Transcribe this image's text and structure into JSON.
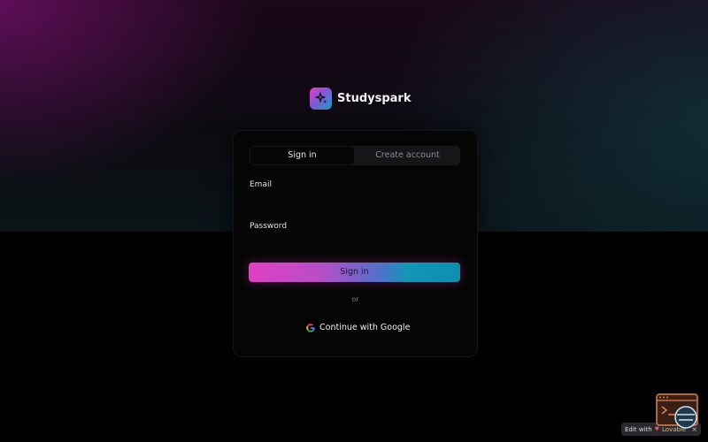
{
  "brand": {
    "name": "Studyspark",
    "logo_icon": "sparkles-icon",
    "logo_colors": [
      "#e43cc0",
      "#1aa6c9"
    ]
  },
  "auth": {
    "tabs": [
      {
        "label": "Sign in",
        "active": true
      },
      {
        "label": "Create account",
        "active": false
      }
    ],
    "email_label": "Email",
    "email_value": "",
    "password_label": "Password",
    "password_value": "",
    "submit_label": "Sign in",
    "divider_text": "or",
    "google_label": "Continue with Google",
    "google_icon": "google-icon"
  },
  "badge": {
    "prefix": "Edit with",
    "name": "Lovable",
    "close": "×"
  },
  "colors": {
    "accent_pink": "#e03fc4",
    "accent_teal": "#1296b8",
    "card_bg": "#050505",
    "page_bg": "#000000"
  }
}
